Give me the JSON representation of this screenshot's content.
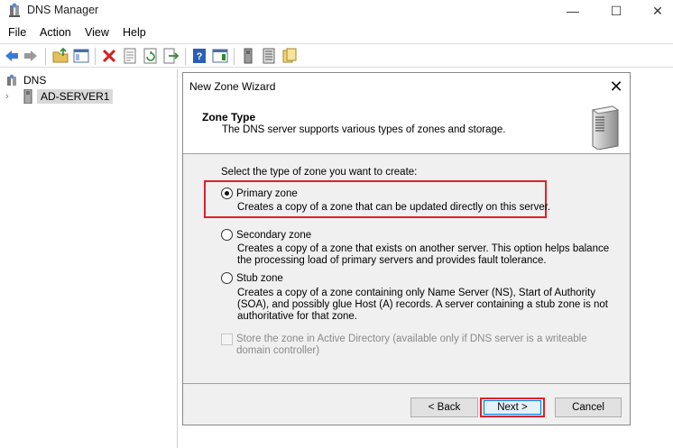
{
  "app": {
    "title": "DNS Manager"
  },
  "window_controls": {
    "minimize": "—",
    "maximize": "☐",
    "close": "✕"
  },
  "menu": {
    "items": [
      "File",
      "Action",
      "View",
      "Help"
    ]
  },
  "toolbar": {
    "icons": [
      "back-arrow-icon",
      "forward-arrow-icon",
      "up-folder-icon",
      "show-hide-tree-icon",
      "delete-icon",
      "properties-icon",
      "refresh-icon",
      "export-icon",
      "help-icon",
      "action-pane-icon",
      "server-icon",
      "list-icon",
      "zone-icon"
    ]
  },
  "tree": {
    "root_label": "DNS",
    "child_label": "AD-SERVER1",
    "child_chevron": "›"
  },
  "wizard": {
    "title": "New Zone Wizard",
    "close": "✕",
    "header_title": "Zone Type",
    "header_subtitle": "The DNS server supports various types of zones and storage.",
    "prompt": "Select the type of zone you want to create:",
    "options": [
      {
        "label": "Primary zone",
        "description": "Creates a copy of a zone that can be updated directly on this server.",
        "selected": true
      },
      {
        "label": "Secondary zone",
        "description": "Creates a copy of a zone that exists on another server. This option helps balance the processing load of primary servers and provides fault tolerance.",
        "selected": false
      },
      {
        "label": "Stub zone",
        "description": "Creates a copy of a zone containing only Name Server (NS), Start of Authority (SOA), and possibly glue Host (A) records. A server containing a stub zone is not authoritative for that zone.",
        "selected": false
      }
    ],
    "store_in_ad": {
      "label": "Store the zone in Active Directory (available only if DNS server is a writeable domain controller)",
      "checked": false,
      "enabled": false
    },
    "buttons": {
      "back": "< Back",
      "next": "Next >",
      "cancel": "Cancel"
    }
  },
  "colors": {
    "highlight": "#e0202a",
    "selection_gray": "#d9d9d9",
    "dialog_bg": "#f0f0f0"
  }
}
